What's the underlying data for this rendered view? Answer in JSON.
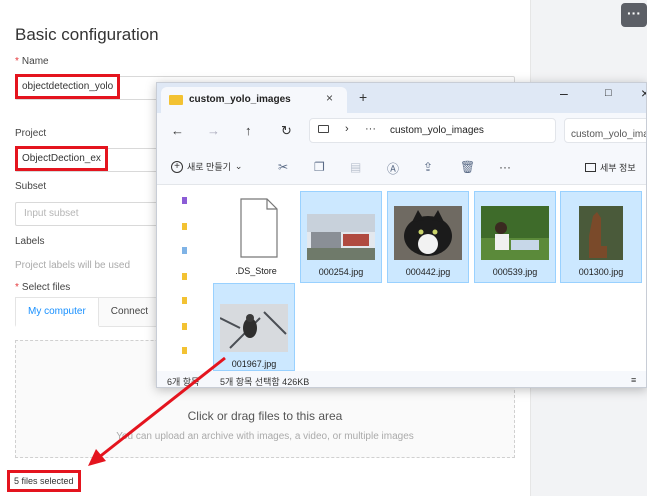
{
  "form": {
    "title": "Basic configuration",
    "name_label": "Name",
    "name_value": "objectdetection_yolo",
    "project_label": "Project",
    "project_value": "ObjectDection_ex",
    "subset_label": "Subset",
    "subset_placeholder": "Input subset",
    "labels_label": "Labels",
    "labels_hint": "Project labels will be used",
    "select_files_label": "Select files",
    "tabs": [
      "My computer",
      "Connect"
    ],
    "drop_title": "Click or drag files to this area",
    "drop_sub": "You can upload an archive with images, a video, or multiple images",
    "files_selected": "5 files selected",
    "required_mark": "*"
  },
  "right_panel": {
    "more_label": "···"
  },
  "explorer": {
    "tab_title": "custom_yolo_images",
    "tab_close": "×",
    "new_tab": "+",
    "window_controls": {
      "minimize": "–",
      "maximize": "□",
      "close": "×"
    },
    "nav": {
      "back": "←",
      "forward": "→",
      "up": "↑",
      "refresh": "↻"
    },
    "address": {
      "chevron": "›",
      "ellipsis": "···",
      "folder": "custom_yolo_images"
    },
    "search_placeholder": "custom_yolo_images 검색",
    "command_bar": {
      "new_label": "새로 만들기",
      "new_caret": "⌄",
      "more": "···",
      "details_label": "세부 정보"
    },
    "files": [
      {
        "name": ".DS_Store",
        "type": "document",
        "selected": false
      },
      {
        "name": "000254.jpg",
        "type": "image",
        "selected": true
      },
      {
        "name": "000442.jpg",
        "type": "image",
        "selected": true
      },
      {
        "name": "000539.jpg",
        "type": "image",
        "selected": true
      },
      {
        "name": "001300.jpg",
        "type": "image",
        "selected": true
      },
      {
        "name": "001967.jpg",
        "type": "image",
        "selected": true
      }
    ],
    "status": {
      "count": "6개 항목",
      "selection": "5개 항목 선택함 426KB"
    },
    "view_icon": "≡"
  },
  "colors": {
    "highlight": "#e4141e",
    "accent": "#1890ff",
    "selection": "#cce8ff"
  }
}
